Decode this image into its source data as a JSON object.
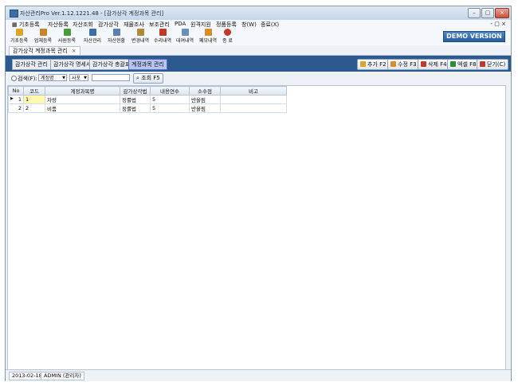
{
  "window": {
    "title": "자산관리Pro Ver.1.12.1221.48 - [감가상각 계정과목 관리]"
  },
  "menu": [
    "기초등록",
    "자산등록",
    "자산조회",
    "감가상각",
    "재물조사",
    "보조관리",
    "PDA",
    "원격지원",
    "정품등록",
    "창(W)",
    "종료(X)"
  ],
  "mdi_controls": "- ▢ ×",
  "toolbar": [
    {
      "label": "기초등록",
      "icon": "folder-icon",
      "color": "#d9a62a"
    },
    {
      "label": "업체등록",
      "icon": "building-icon",
      "color": "#c9842d"
    },
    {
      "label": "사원등록",
      "icon": "users-icon",
      "color": "#4a9a3c"
    },
    {
      "label": "자산관리",
      "icon": "asset-icon",
      "color": "#3b6ea5"
    },
    {
      "label": "자산현황",
      "icon": "chart-icon",
      "color": "#5b7fb0"
    },
    {
      "label": "변경내역",
      "icon": "edit-icon",
      "color": "#b08a3a"
    },
    {
      "label": "수리내역",
      "icon": "wrench-icon",
      "color": "#c0392b"
    },
    {
      "label": "대여내역",
      "icon": "handover-icon",
      "color": "#6a8fbf"
    },
    {
      "label": "폐모내역",
      "icon": "disposal-icon",
      "color": "#d98c2a"
    },
    {
      "label": "종 료",
      "icon": "power-icon",
      "color": "#c0392b"
    }
  ],
  "demo_badge": "DEMO VERSION",
  "doc_tab": {
    "label": "감가상각 계정과목 관리",
    "close": "×"
  },
  "sub_tabs": [
    "감가상각 관리",
    "감가상각 명세서",
    "감가상각 총괄표",
    "계정과목 관리"
  ],
  "actions": [
    {
      "label": "추가 F2",
      "icon": "add-icon",
      "color": "#d9a62a"
    },
    {
      "label": "수정 F3",
      "icon": "edit-icon",
      "color": "#d98c2a"
    },
    {
      "label": "삭제 F4",
      "icon": "delete-icon",
      "color": "#c0392b"
    },
    {
      "label": "엑셀 F8",
      "icon": "excel-icon",
      "color": "#2e8b3d"
    },
    {
      "label": "닫기(C)",
      "icon": "close-icon",
      "color": "#c0392b"
    }
  ],
  "search": {
    "label": "검색(F):",
    "field": "계정명",
    "operator": "사포",
    "value": "",
    "button": "조회 F5"
  },
  "grid": {
    "columns": [
      "No",
      "코드",
      "계정과목명",
      "감가상각법",
      "내용연수",
      "소수점",
      "비고"
    ],
    "rows": [
      [
        "1",
        "1",
        "차량",
        "정률법",
        "5",
        "반올림",
        ""
      ],
      [
        "2",
        "2",
        "비품",
        "정률법",
        "5",
        "반올림",
        ""
      ]
    ]
  },
  "status": {
    "date": "2013-02-18",
    "user": "ADMIN (관리자)"
  }
}
